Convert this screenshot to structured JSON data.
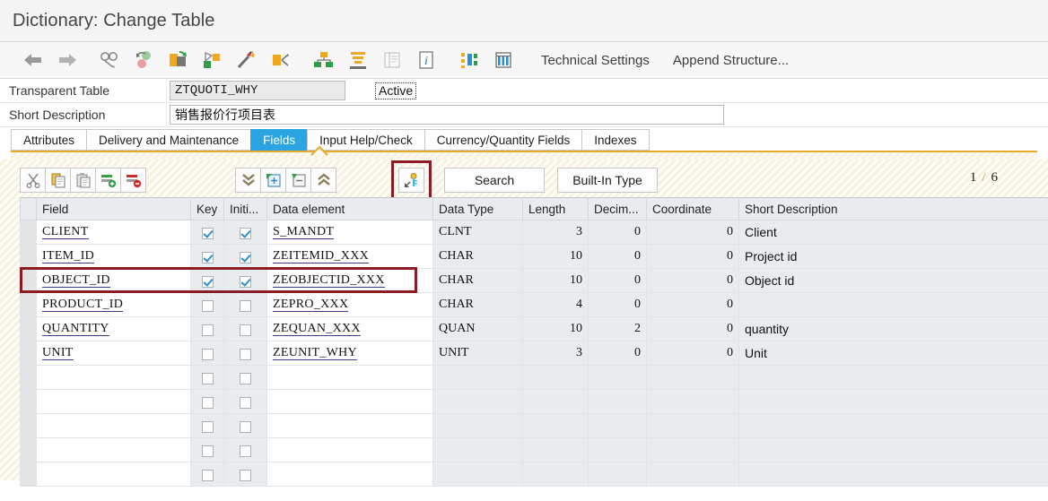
{
  "window": {
    "title": "Dictionary: Change Table"
  },
  "main_toolbar": {
    "icons": [
      {
        "name": "back-arrow-icon",
        "glyph": "←"
      },
      {
        "name": "forward-arrow-icon",
        "glyph": "→"
      },
      {
        "name": "display-change-glasses-icon",
        "glyph": ""
      },
      {
        "name": "refresh-check-icon",
        "glyph": ""
      },
      {
        "name": "activate-icon",
        "glyph": ""
      },
      {
        "name": "check-object-icon",
        "glyph": ""
      },
      {
        "name": "magic-wand-icon",
        "glyph": ""
      },
      {
        "name": "extras-icon",
        "glyph": ""
      },
      {
        "name": "hierarchy-icon",
        "glyph": ""
      },
      {
        "name": "database-utility-icon",
        "glyph": ""
      },
      {
        "name": "documentation-icon",
        "glyph": ""
      },
      {
        "name": "info-icon",
        "glyph": "i"
      },
      {
        "name": "where-used-list-icon",
        "glyph": ""
      },
      {
        "name": "table-contents-icon",
        "glyph": ""
      }
    ],
    "technical_settings_label": "Technical Settings",
    "append_structure_label": "Append Structure..."
  },
  "attributes": {
    "table_type_label": "Transparent Table",
    "table_name_value": "ZTQUOTI_WHY",
    "status_label": "Active",
    "short_description_label": "Short Description",
    "short_description_value": "销售报价行项目表"
  },
  "tabs": [
    {
      "label": "Attributes",
      "active": false
    },
    {
      "label": "Delivery and Maintenance",
      "active": false
    },
    {
      "label": "Fields",
      "active": true
    },
    {
      "label": "Input Help/Check",
      "active": false
    },
    {
      "label": "Currency/Quantity Fields",
      "active": false
    },
    {
      "label": "Indexes",
      "active": false
    }
  ],
  "sub_toolbar": {
    "buttons": [
      {
        "name": "cut-button",
        "icon": "scissors-icon"
      },
      {
        "name": "copy-button",
        "icon": "copy-icon"
      },
      {
        "name": "paste-button",
        "icon": "clipboard-icon"
      },
      {
        "name": "insert-row-button",
        "icon": "insert-row-icon"
      },
      {
        "name": "delete-row-button",
        "icon": "delete-row-icon"
      },
      {
        "name": "scroll-down-button",
        "icon": "double-chevron-down-icon"
      },
      {
        "name": "new-rows-button",
        "icon": "new-rows-icon"
      },
      {
        "name": "remove-rows-button",
        "icon": "remove-rows-icon"
      },
      {
        "name": "scroll-up-button",
        "icon": "double-chevron-up-icon"
      }
    ],
    "key_button": {
      "name": "srch-help-key-button",
      "icon": "key-icon",
      "highlighted": true
    },
    "search_label": "Search",
    "builtin_type_label": "Built-In Type",
    "pager_current": "1",
    "pager_separator": "/",
    "pager_total": "6"
  },
  "grid": {
    "columns": [
      {
        "key": "field",
        "label": "Field"
      },
      {
        "key": "key",
        "label": "Key"
      },
      {
        "key": "initial",
        "label": "Initi..."
      },
      {
        "key": "data_element",
        "label": "Data element"
      },
      {
        "key": "data_type",
        "label": "Data Type"
      },
      {
        "key": "length",
        "label": "Length"
      },
      {
        "key": "decimals",
        "label": "Decim..."
      },
      {
        "key": "coordinate",
        "label": "Coordinate"
      },
      {
        "key": "short_description",
        "label": "Short Description"
      }
    ],
    "rows": [
      {
        "field": "CLIENT",
        "key": true,
        "initial": true,
        "data_element": "S_MANDT",
        "data_type": "CLNT",
        "length": "3",
        "decimals": "0",
        "coordinate": "0",
        "short_description": "Client",
        "highlighted": false
      },
      {
        "field": "ITEM_ID",
        "key": true,
        "initial": true,
        "data_element": "ZEITEMID_XXX",
        "data_type": "CHAR",
        "length": "10",
        "decimals": "0",
        "coordinate": "0",
        "short_description": "Project id",
        "highlighted": false
      },
      {
        "field": "OBJECT_ID",
        "key": true,
        "initial": true,
        "data_element": "ZEOBJECTID_XXX",
        "data_type": "CHAR",
        "length": "10",
        "decimals": "0",
        "coordinate": "0",
        "short_description": "Object id",
        "highlighted": true
      },
      {
        "field": "PRODUCT_ID",
        "key": false,
        "initial": false,
        "data_element": "ZEPRO_XXX",
        "data_type": "CHAR",
        "length": "4",
        "decimals": "0",
        "coordinate": "0",
        "short_description": "",
        "highlighted": false
      },
      {
        "field": "QUANTITY",
        "key": false,
        "initial": false,
        "data_element": "ZEQUAN_XXX",
        "data_type": "QUAN",
        "length": "10",
        "decimals": "2",
        "coordinate": "0",
        "short_description": "quantity",
        "highlighted": false
      },
      {
        "field": "UNIT",
        "key": false,
        "initial": false,
        "data_element": "ZEUNIT_WHY",
        "data_type": "UNIT",
        "length": "3",
        "decimals": "0",
        "coordinate": "0",
        "short_description": "Unit",
        "highlighted": false
      }
    ],
    "empty_row_count": 5
  },
  "colors": {
    "active_tab": "#2aa5e2",
    "highlight_box": "#8c1c24",
    "tab_underline": "#e8a72a",
    "grid_header": "#e9ecef"
  }
}
